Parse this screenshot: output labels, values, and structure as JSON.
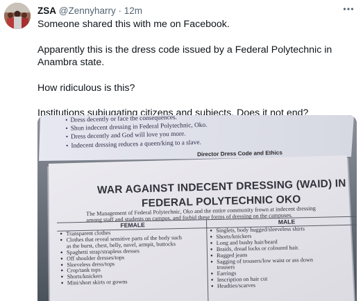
{
  "tweet": {
    "display_name": "ZSA",
    "handle": "@Zennyharry",
    "separator": "·",
    "time": "12m",
    "more_icon": "more-dots-icon",
    "paragraphs": [
      "Someone shared this with me on Facebook.",
      "Apparently this is the dress code issued by a Federal Polytechnic in Anambra state.",
      "How ridiculous is this?",
      "Institutions subjugating citizens and subjects. Does it not end?"
    ]
  },
  "photo": {
    "top_notice": [
      "Dress decently or face the consequences.",
      "Shun indecent dressing in Federal Polytechnic, Oko.",
      "Dress decently and God will love you more.",
      "Indecent dressing reduces a queen/king to a slave."
    ],
    "top_signature": "Director Dress Code and Ethics",
    "title_line1": "WAR AGAINST INDECENT DRESSING (WAID) IN",
    "title_line2": "FEDERAL POLYTECHNIC OKO",
    "intro_line1": "The Management of Federal Polytechnic, Oko and the entire community frown at indecent dressing",
    "intro_line2": "among staff and students on campus, and forbid these forms of dressing on the campuses.",
    "female_header": "FEMALE",
    "male_header": "MALE",
    "female_items": [
      "Transparent clothes",
      "Clothes that reveal sensitive parts of the body such",
      "as the burst, chest, belly, navel, armpit, buttocks",
      "Spaghetti strap/strapless dresses",
      "Off shoulder dresses/tops",
      "Sleeveless dress/tops",
      "Crop/tank tops",
      "Shorts/knickers",
      "Mini/short skirts or gowns"
    ],
    "male_items": [
      "Singlets, body hugged/sleeveless shirts",
      "Shorts/knickers",
      "Long and bushy hair/beard",
      "Braids, dread locks or coloured hair.",
      "Rugged jeans",
      "Sagging of trousers/low waist or   ass down",
      "trousers",
      "Earrings",
      "Inscription on hair cut",
      "Headties/scarves"
    ]
  }
}
